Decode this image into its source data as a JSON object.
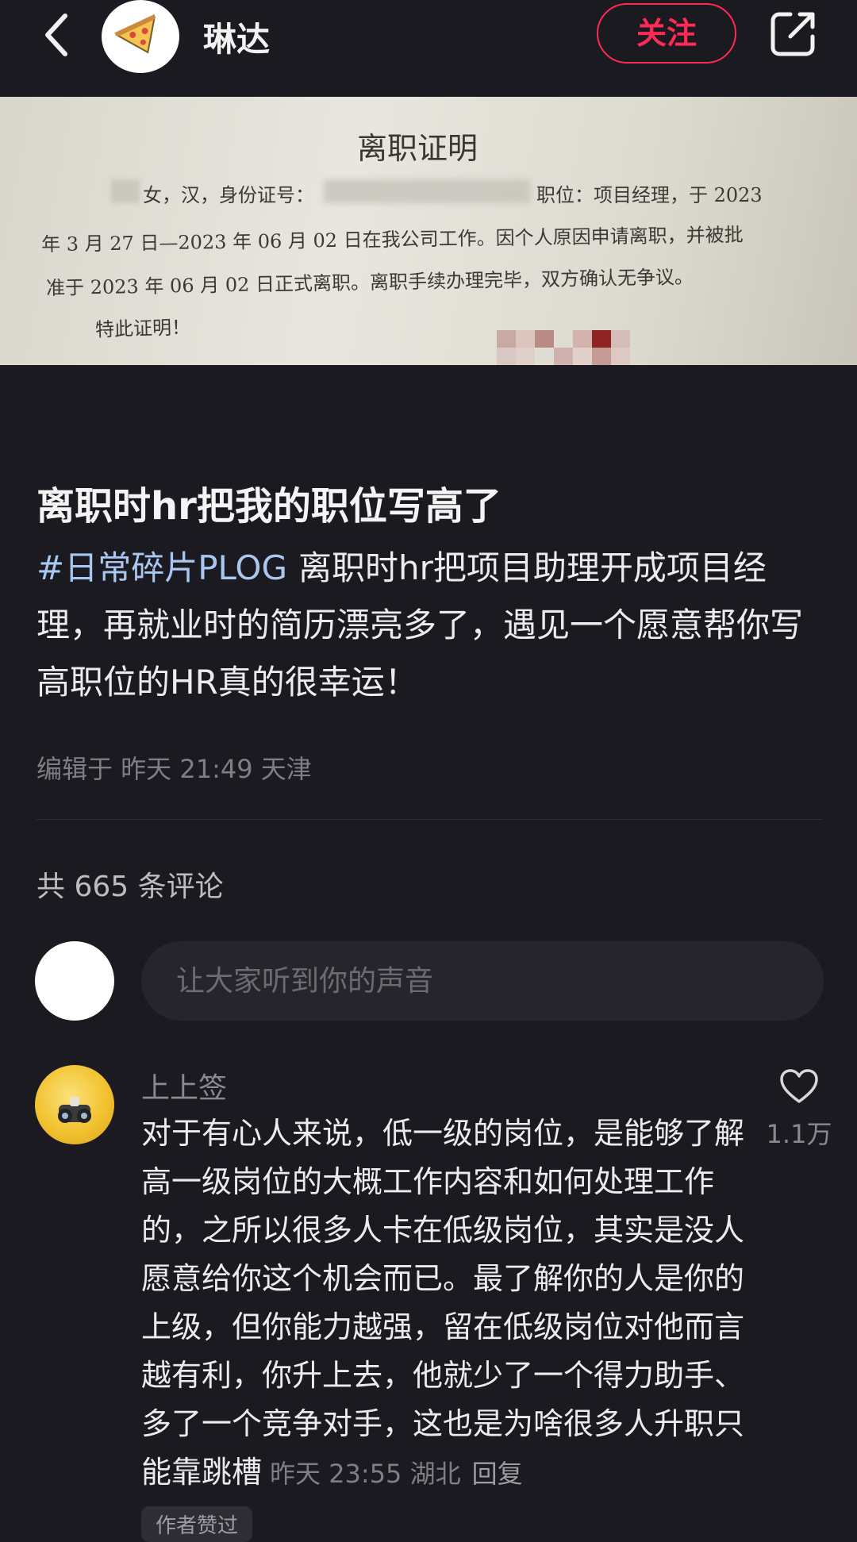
{
  "header": {
    "author_name": "琳达",
    "follow_label": "关注",
    "icons": [
      "chevron-left-icon",
      "pizza-icon",
      "share-icon"
    ]
  },
  "hero_image": {
    "doc_title": "离职证明",
    "line1_left": "女，汉，身份证号：",
    "line1_right": "职位：项目经理，于 2023",
    "line2": "年 3 月 27 日—2023 年 06 月 02 日在我公司工作。因个人原因申请离职，并被批",
    "line3": "准于 2023 年 06 月 02 日正式离职。离职手续办理完毕，双方确认无争议。",
    "line4": "特此证明！"
  },
  "post": {
    "title": "离职时hr把我的职位写高了",
    "hashtag": "#日常碎片PLOG",
    "body": "离职时hr把项目助理开成项目经理，再就业时的简历漂亮多了，遇见一个愿意帮你写高职位的HR真的很幸运！",
    "edit_meta": "编辑于 昨天 21:49 天津"
  },
  "comments": {
    "count_label": "共 665 条评论",
    "input_placeholder": "让大家听到你的声音",
    "items": [
      {
        "name": "上上签",
        "text": "对于有心人来说，低一级的岗位，是能够了解高一级岗位的大概工作内容和如何处理工作的，之所以很多人卡在低级岗位，其实是没人愿意给你这个机会而已。最了解你的人是你的上级，但你能力越强，留在低级岗位对他而言越有利，你升上去，他就少了一个得力助手、多了一个竞争对手，这也是为啥很多人升职只能靠跳槽",
        "meta": "昨天 23:55 湖北",
        "reply_label": "回复",
        "like_count": "1.1万",
        "badge": "作者赞过"
      }
    ]
  },
  "colors": {
    "background": "#1b1a20",
    "accent": "#ff2a55",
    "hashtag": "#a9c7f0"
  }
}
